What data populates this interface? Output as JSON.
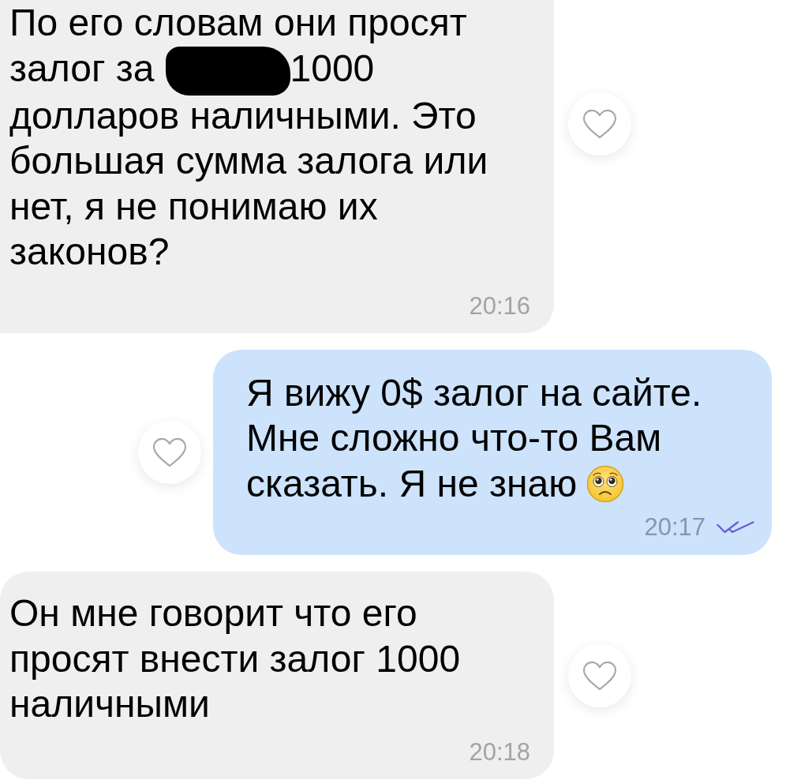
{
  "messages": [
    {
      "kind": "incoming",
      "parts": [
        {
          "kind": "text",
          "text": "По его словам они просят залог за"
        },
        {
          "kind": "redaction"
        },
        {
          "kind": "text",
          "text": "1000 долларов наличными. Это большая сумма залога или нет, я не понимаю их законов?"
        }
      ],
      "time": "20:16",
      "liked": false
    },
    {
      "kind": "outgoing",
      "parts": [
        {
          "kind": "text",
          "text": "Я вижу 0$ залог на сайте. Мне сложно что-то Вам сказать. Я не знаю"
        },
        {
          "kind": "emoji"
        }
      ],
      "time": "20:17",
      "read": true,
      "liked": false
    },
    {
      "kind": "incoming",
      "parts": [
        {
          "kind": "text",
          "text": "Он мне говорит что его просят внести залог 1000 наличными"
        }
      ],
      "time": "20:18",
      "liked": false
    }
  ]
}
